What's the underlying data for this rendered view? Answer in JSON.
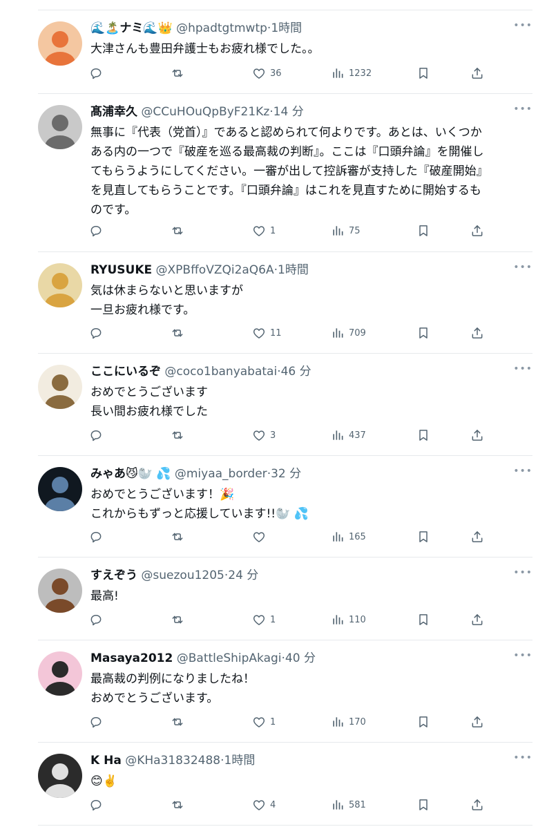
{
  "tweets": [
    {
      "name": "ナミ",
      "name_prefix_emoji": "🌊🏝️",
      "name_suffix_emoji": "🌊👑",
      "handle": "@hpadtgtmwtp",
      "sep": "·",
      "time": "1時間",
      "lines": [
        "大津さんも豊田弁護士もお疲れ様でした。。"
      ],
      "likes": "36",
      "views": "1232",
      "avatar_colors": [
        "#f4c7a1",
        "#e8743b"
      ]
    },
    {
      "name": "髙浦幸久",
      "name_prefix_emoji": "",
      "name_suffix_emoji": "",
      "handle": "@CCuHOuQpByF21Kz",
      "sep": "·",
      "time": "14 分",
      "lines": [
        "無事に『代表（党首）』であると認められて何よりです。あとは、いくつか",
        "ある内の一つで『破産を巡る最高裁の判断』。ここは『口頭弁論』を開催し",
        "てもらうようにしてください。一審が出して控訴審が支持した『破産開始』",
        "を見直してもらうことです。『口頭弁論』はこれを見直すために開始するも",
        "のです。"
      ],
      "likes": "1",
      "views": "75",
      "avatar_colors": [
        "#c9c9c9",
        "#6b6b6b"
      ]
    },
    {
      "name": "RYUSUKE",
      "name_prefix_emoji": "",
      "name_suffix_emoji": "",
      "handle": "@XPBffoVZQi2aQ6A",
      "sep": "·",
      "time": "1時間",
      "lines": [
        "気は休まらないと思いますが",
        "一旦お疲れ様です。"
      ],
      "likes": "11",
      "views": "709",
      "avatar_colors": [
        "#e9d8a6",
        "#d9a441"
      ]
    },
    {
      "name": "ここにいるぞ",
      "name_prefix_emoji": "",
      "name_suffix_emoji": "",
      "handle": "@coco1banyabatai",
      "sep": "·",
      "time": "46 分",
      "lines": [
        "おめでとうございます",
        "長い間お疲れ様でした"
      ],
      "likes": "3",
      "views": "437",
      "avatar_colors": [
        "#f2ece0",
        "#8a6b3f"
      ]
    },
    {
      "name": "みゃあ",
      "name_prefix_emoji": "",
      "name_suffix_emoji": "😼🦭 💦",
      "handle": "@miyaa_border",
      "sep": "·",
      "time": "32 分",
      "lines": [
        "おめでとうございます！🎉",
        "これからもずっと応援しています!!🦭 💦"
      ],
      "likes": "",
      "views": "165",
      "avatar_colors": [
        "#101820",
        "#5b7fa6"
      ]
    },
    {
      "name": "すえぞう",
      "name_prefix_emoji": "",
      "name_suffix_emoji": "",
      "handle": "@suezou1205",
      "sep": "·",
      "time": "24 分",
      "lines": [
        "最高!"
      ],
      "likes": "1",
      "views": "110",
      "avatar_colors": [
        "#bdbdbd",
        "#7a4a2a"
      ]
    },
    {
      "name": "Masaya2012",
      "name_prefix_emoji": "",
      "name_suffix_emoji": "",
      "handle": "@BattleShipAkagi",
      "sep": "·",
      "time": "40 分",
      "lines": [
        "最高裁の判例になりましたね！",
        "おめでとうございます。"
      ],
      "likes": "1",
      "views": "170",
      "avatar_colors": [
        "#f3c6d8",
        "#2b2b2b"
      ]
    },
    {
      "name": "K Ha",
      "name_prefix_emoji": "",
      "name_suffix_emoji": "",
      "handle": "@KHa31832488",
      "sep": "·",
      "time": "1時間",
      "lines": [
        "😊✌️"
      ],
      "likes": "4",
      "views": "581",
      "avatar_colors": [
        "#2b2b2b",
        "#e0e0e0"
      ]
    }
  ],
  "ui": {
    "more": "•••",
    "text_color": "#0f1419",
    "muted_color": "#536471",
    "divider_color": "#e6e9ec"
  }
}
